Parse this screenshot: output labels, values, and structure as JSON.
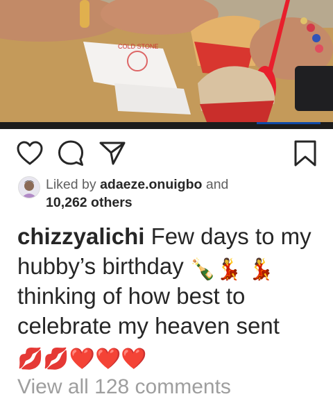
{
  "post": {
    "photo_alt": "ice cream cups on a table",
    "liked_by_prefix": "Liked by",
    "liked_by_user": "adaeze.onuigbo",
    "liked_by_and": "and",
    "liked_by_others": "10,262 others",
    "caption_user": "chizzyalichi",
    "caption_text_1": "Few days to my hubby’s birthday",
    "caption_emoji_1": "🍾💃",
    "caption_emoji_2": "💃",
    "caption_text_2": "thinking of how best to celebrate my heaven sent",
    "caption_emoji_3": "💋💋❤️❤️❤️",
    "view_all_comments": "View all 128 comments"
  },
  "icons": {
    "like": "heart-icon",
    "comment": "comment-icon",
    "share": "send-icon",
    "save": "bookmark-icon"
  },
  "colors": {
    "text": "#262626",
    "muted": "#5f5f5f",
    "background": "#ffffff",
    "comments": "#9e9e9e"
  }
}
